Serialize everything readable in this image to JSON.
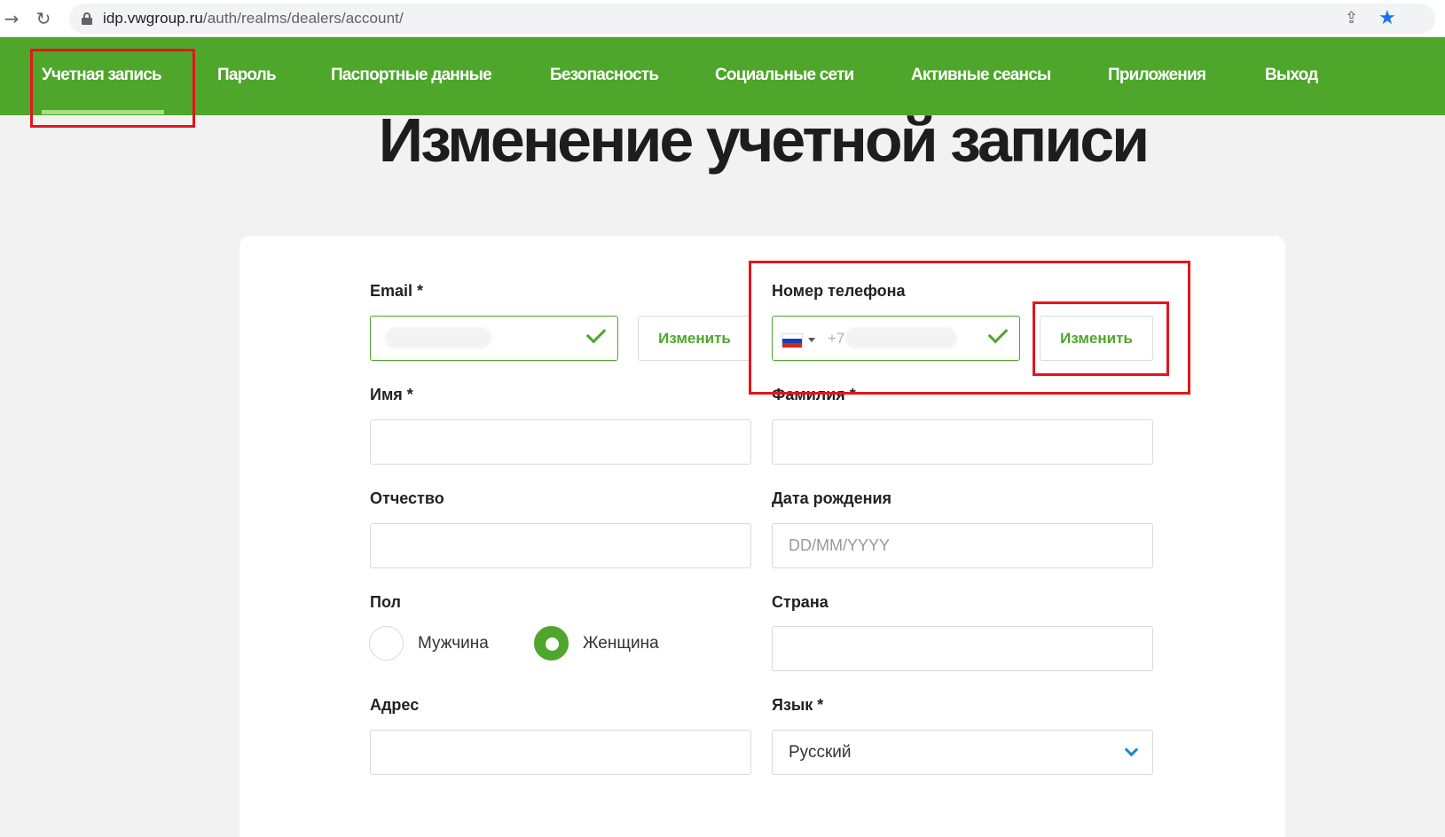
{
  "browser": {
    "url_host": "idp.vwgroup.ru",
    "url_path": "/auth/realms/dealers/account/",
    "back_icon": "arrow-right-icon",
    "reload_icon": "reload-icon"
  },
  "nav": {
    "items": [
      {
        "label": "Учетная запись",
        "active": true
      },
      {
        "label": "Пароль"
      },
      {
        "label": "Паспортные данные"
      },
      {
        "label": "Безопасность"
      },
      {
        "label": "Социальные сети"
      },
      {
        "label": "Активные сеансы"
      },
      {
        "label": "Приложения"
      },
      {
        "label": "Выход"
      }
    ]
  },
  "page": {
    "title": "Изменение учетной записи"
  },
  "form": {
    "email_label": "Email *",
    "email_change": "Изменить",
    "phone_label": "Номер телефона",
    "phone_prefix": "+7",
    "phone_change": "Изменить",
    "first_name_label": "Имя *",
    "last_name_label": "Фамилия *",
    "middle_name_label": "Отчество",
    "birth_label": "Дата рождения",
    "birth_placeholder": "DD/MM/YYYY",
    "gender_label": "Пол",
    "gender_male": "Мужчина",
    "gender_female": "Женщина",
    "gender_selected": "Женщина",
    "country_label": "Страна",
    "address_label": "Адрес",
    "language_label": "Язык *",
    "language_value": "Русский"
  },
  "colors": {
    "brand_green": "#4ea62b",
    "annotation_red": "#e3161b",
    "chevron_blue": "#1e88c7"
  }
}
